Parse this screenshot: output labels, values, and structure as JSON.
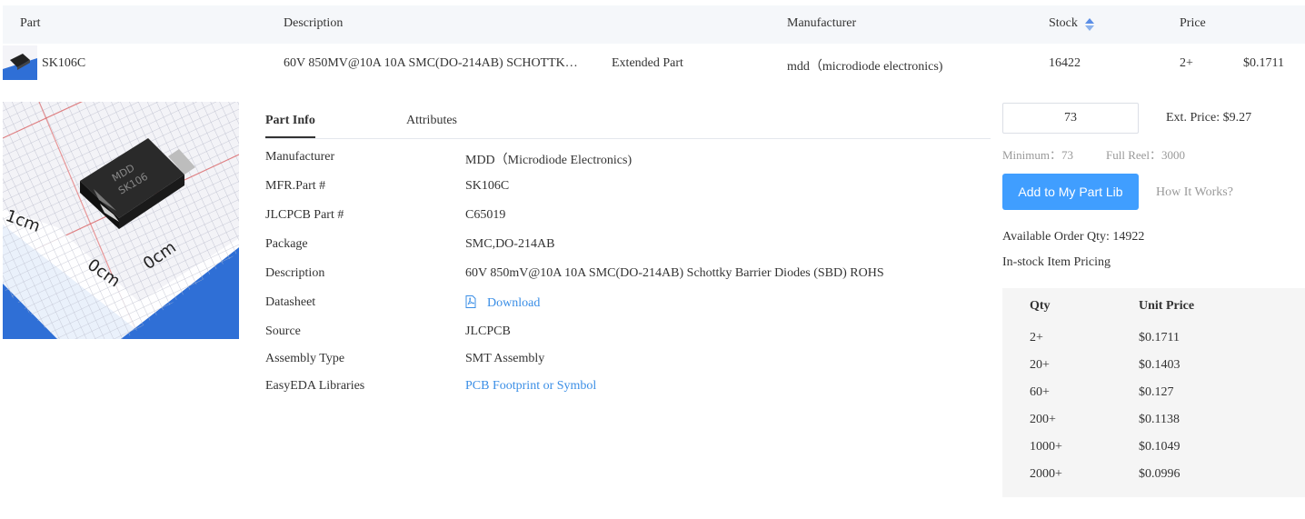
{
  "header": {
    "part": "Part",
    "description": "Description",
    "manufacturer": "Manufacturer",
    "stock": "Stock",
    "price": "Price"
  },
  "part_row": {
    "part_number": "SK106C",
    "description": "60V 850MV@10A 10A SMC(DO-214AB) SCHOTTK…",
    "type": "Extended Part",
    "manufacturer": "mdd（microdiode electronics)",
    "stock": "16422",
    "price_qty": "2+",
    "price": "$0.1711"
  },
  "image": {
    "marking_line1": "MDD",
    "marking_line2": "SK106",
    "ruler_1cm": "1cm",
    "ruler_0cm_a": "0cm",
    "ruler_0cm_b": "0cm"
  },
  "tabs": {
    "part_info": "Part Info",
    "attributes": "Attributes"
  },
  "info": [
    {
      "key": "Manufacturer",
      "value": "MDD（Microdiode Electronics)"
    },
    {
      "key": "MFR.Part #",
      "value": "SK106C"
    },
    {
      "key": "JLCPCB Part #",
      "value": "C65019"
    },
    {
      "key": "Package",
      "value": "SMC,DO-214AB"
    },
    {
      "key": "Description",
      "value": "60V 850mV@10A 10A SMC(DO-214AB) Schottky Barrier Diodes (SBD) ROHS"
    },
    {
      "key": "Datasheet",
      "value": "Download"
    },
    {
      "key": "Source",
      "value": "JLCPCB"
    },
    {
      "key": "Assembly Type",
      "value": "SMT Assembly"
    },
    {
      "key": "EasyEDA Libraries",
      "value": "PCB Footprint or Symbol"
    }
  ],
  "order": {
    "quantity": "73",
    "ext_price": "Ext. Price: $9.27",
    "minimum": "Minimum：73",
    "full_reel": "Full Reel：3000",
    "add_button": "Add to My Part Lib",
    "how_it_works": "How It Works?",
    "available": "Available Order Qty: 14922",
    "instock_pricing": "In-stock Item Pricing"
  },
  "price_table": {
    "qty_header": "Qty",
    "price_header": "Unit Price",
    "rows": [
      {
        "qty": "2+",
        "price": "$0.1711"
      },
      {
        "qty": "20+",
        "price": "$0.1403"
      },
      {
        "qty": "60+",
        "price": "$0.127"
      },
      {
        "qty": "200+",
        "price": "$0.1138"
      },
      {
        "qty": "1000+",
        "price": "$0.1049"
      },
      {
        "qty": "2000+",
        "price": "$0.0996"
      }
    ]
  },
  "colors": {
    "link": "#3a8ee6",
    "button": "#409eff",
    "header_bg": "#f5f7fa",
    "table_bg": "#f5f5f5",
    "ruler_blue": "#2f6fd6"
  },
  "icons": {
    "sort": "sort-arrows-icon",
    "datasheet": "pdf-icon"
  }
}
